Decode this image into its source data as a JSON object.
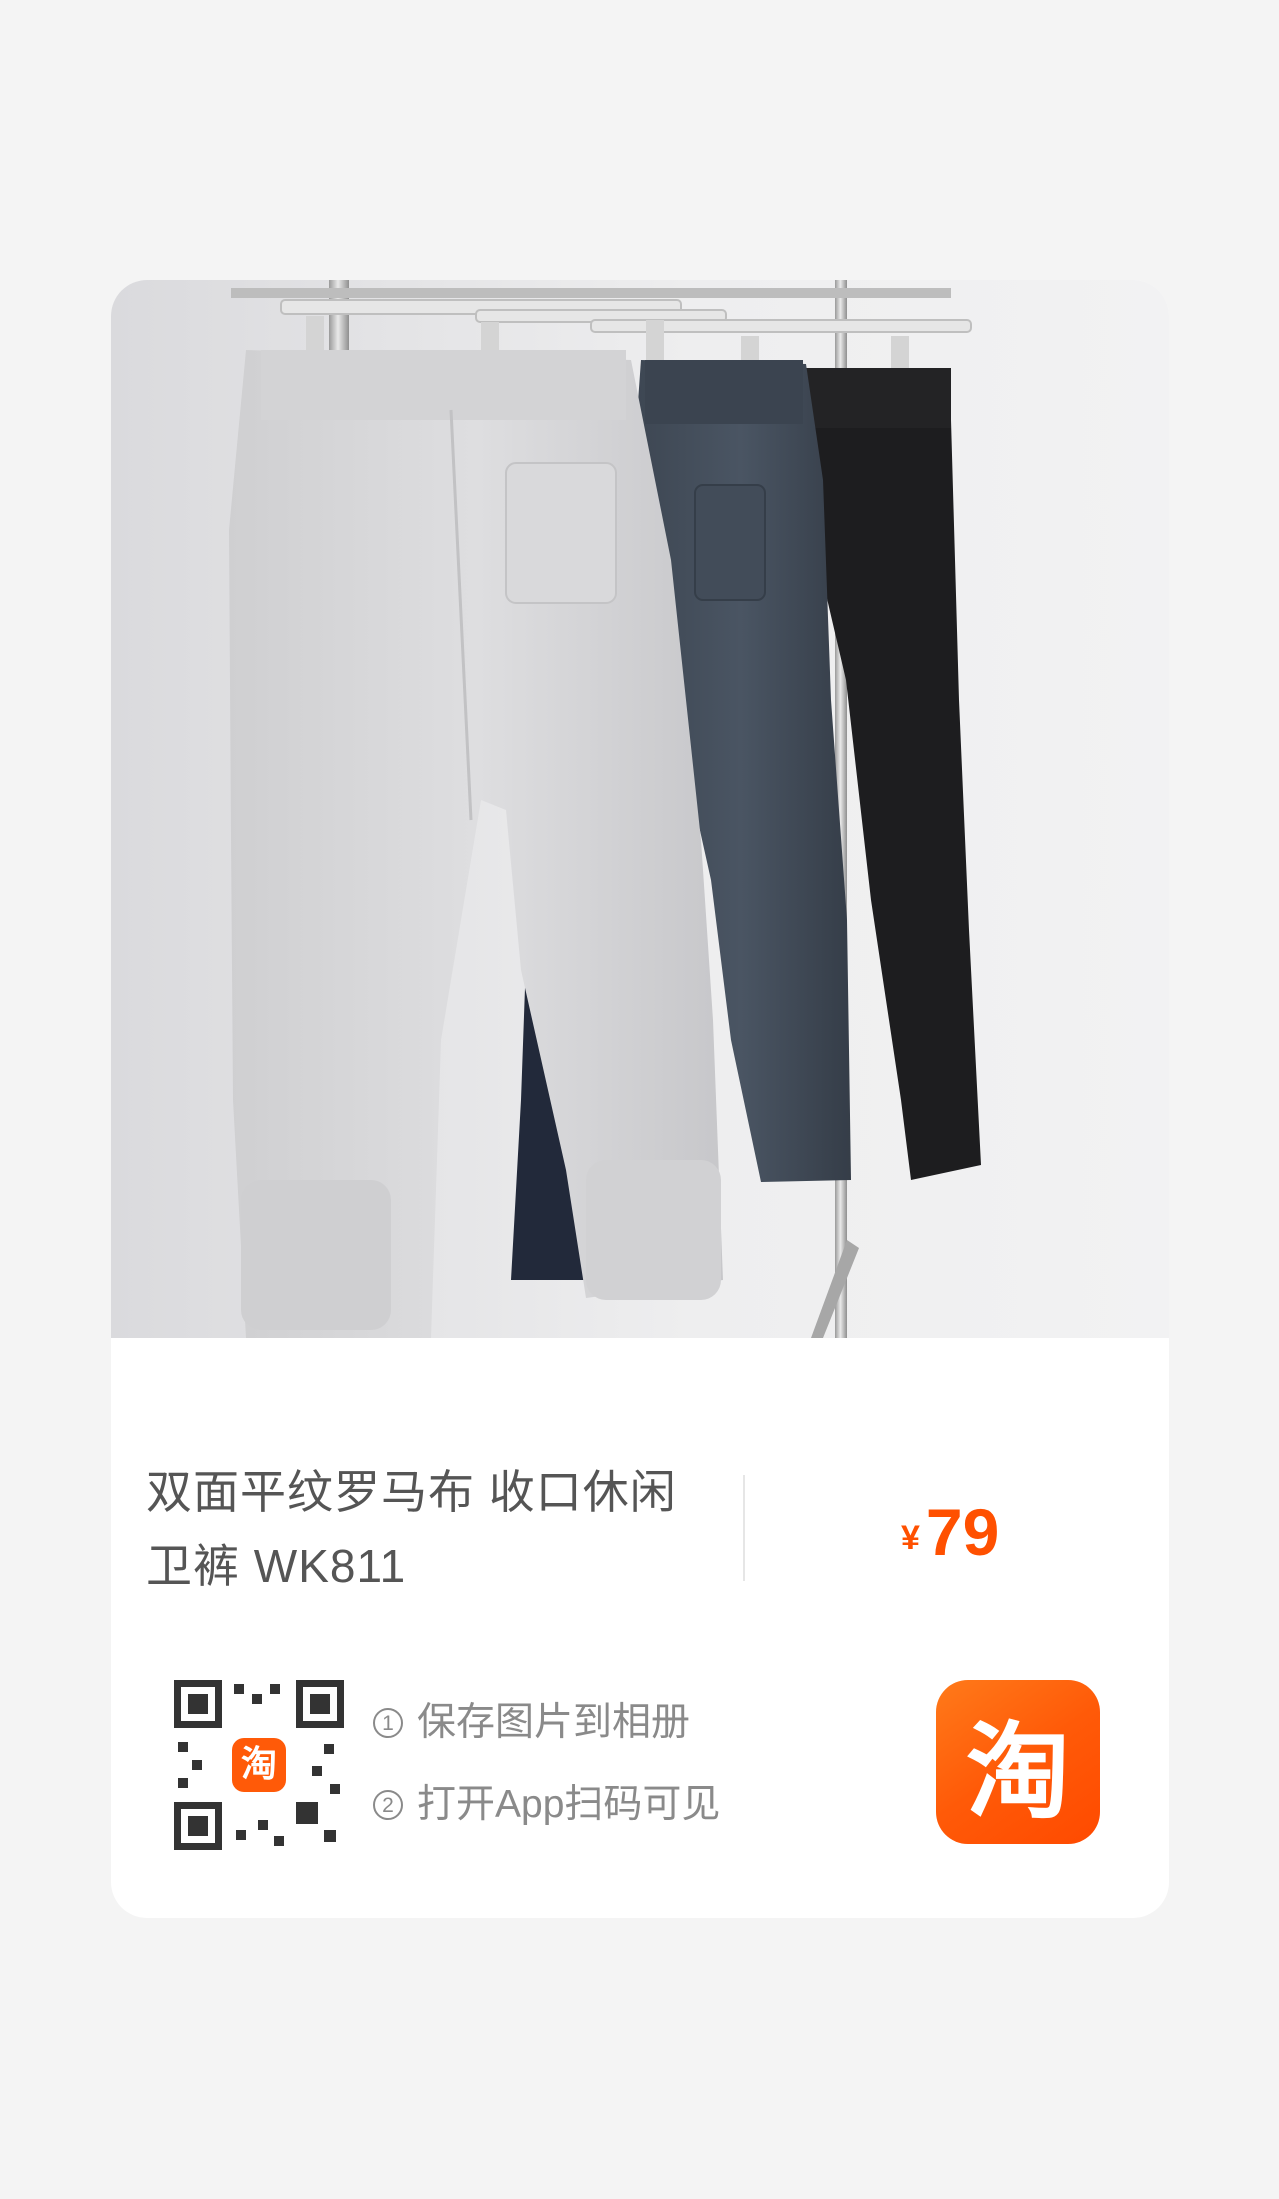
{
  "product": {
    "title": "双面平纹罗马布 收口休闲卫裤 WK811",
    "currency": "¥",
    "price": "79",
    "image_description_icon": "product-photo"
  },
  "share": {
    "steps": [
      {
        "num": "1",
        "text": "保存图片到相册"
      },
      {
        "num": "2",
        "text": "打开App扫码可见"
      }
    ],
    "qr_logo_text": "淘",
    "app_logo_text": "淘"
  },
  "colors": {
    "brand": "#ff5000",
    "text": "#555555",
    "muted": "#8a8a8a"
  }
}
